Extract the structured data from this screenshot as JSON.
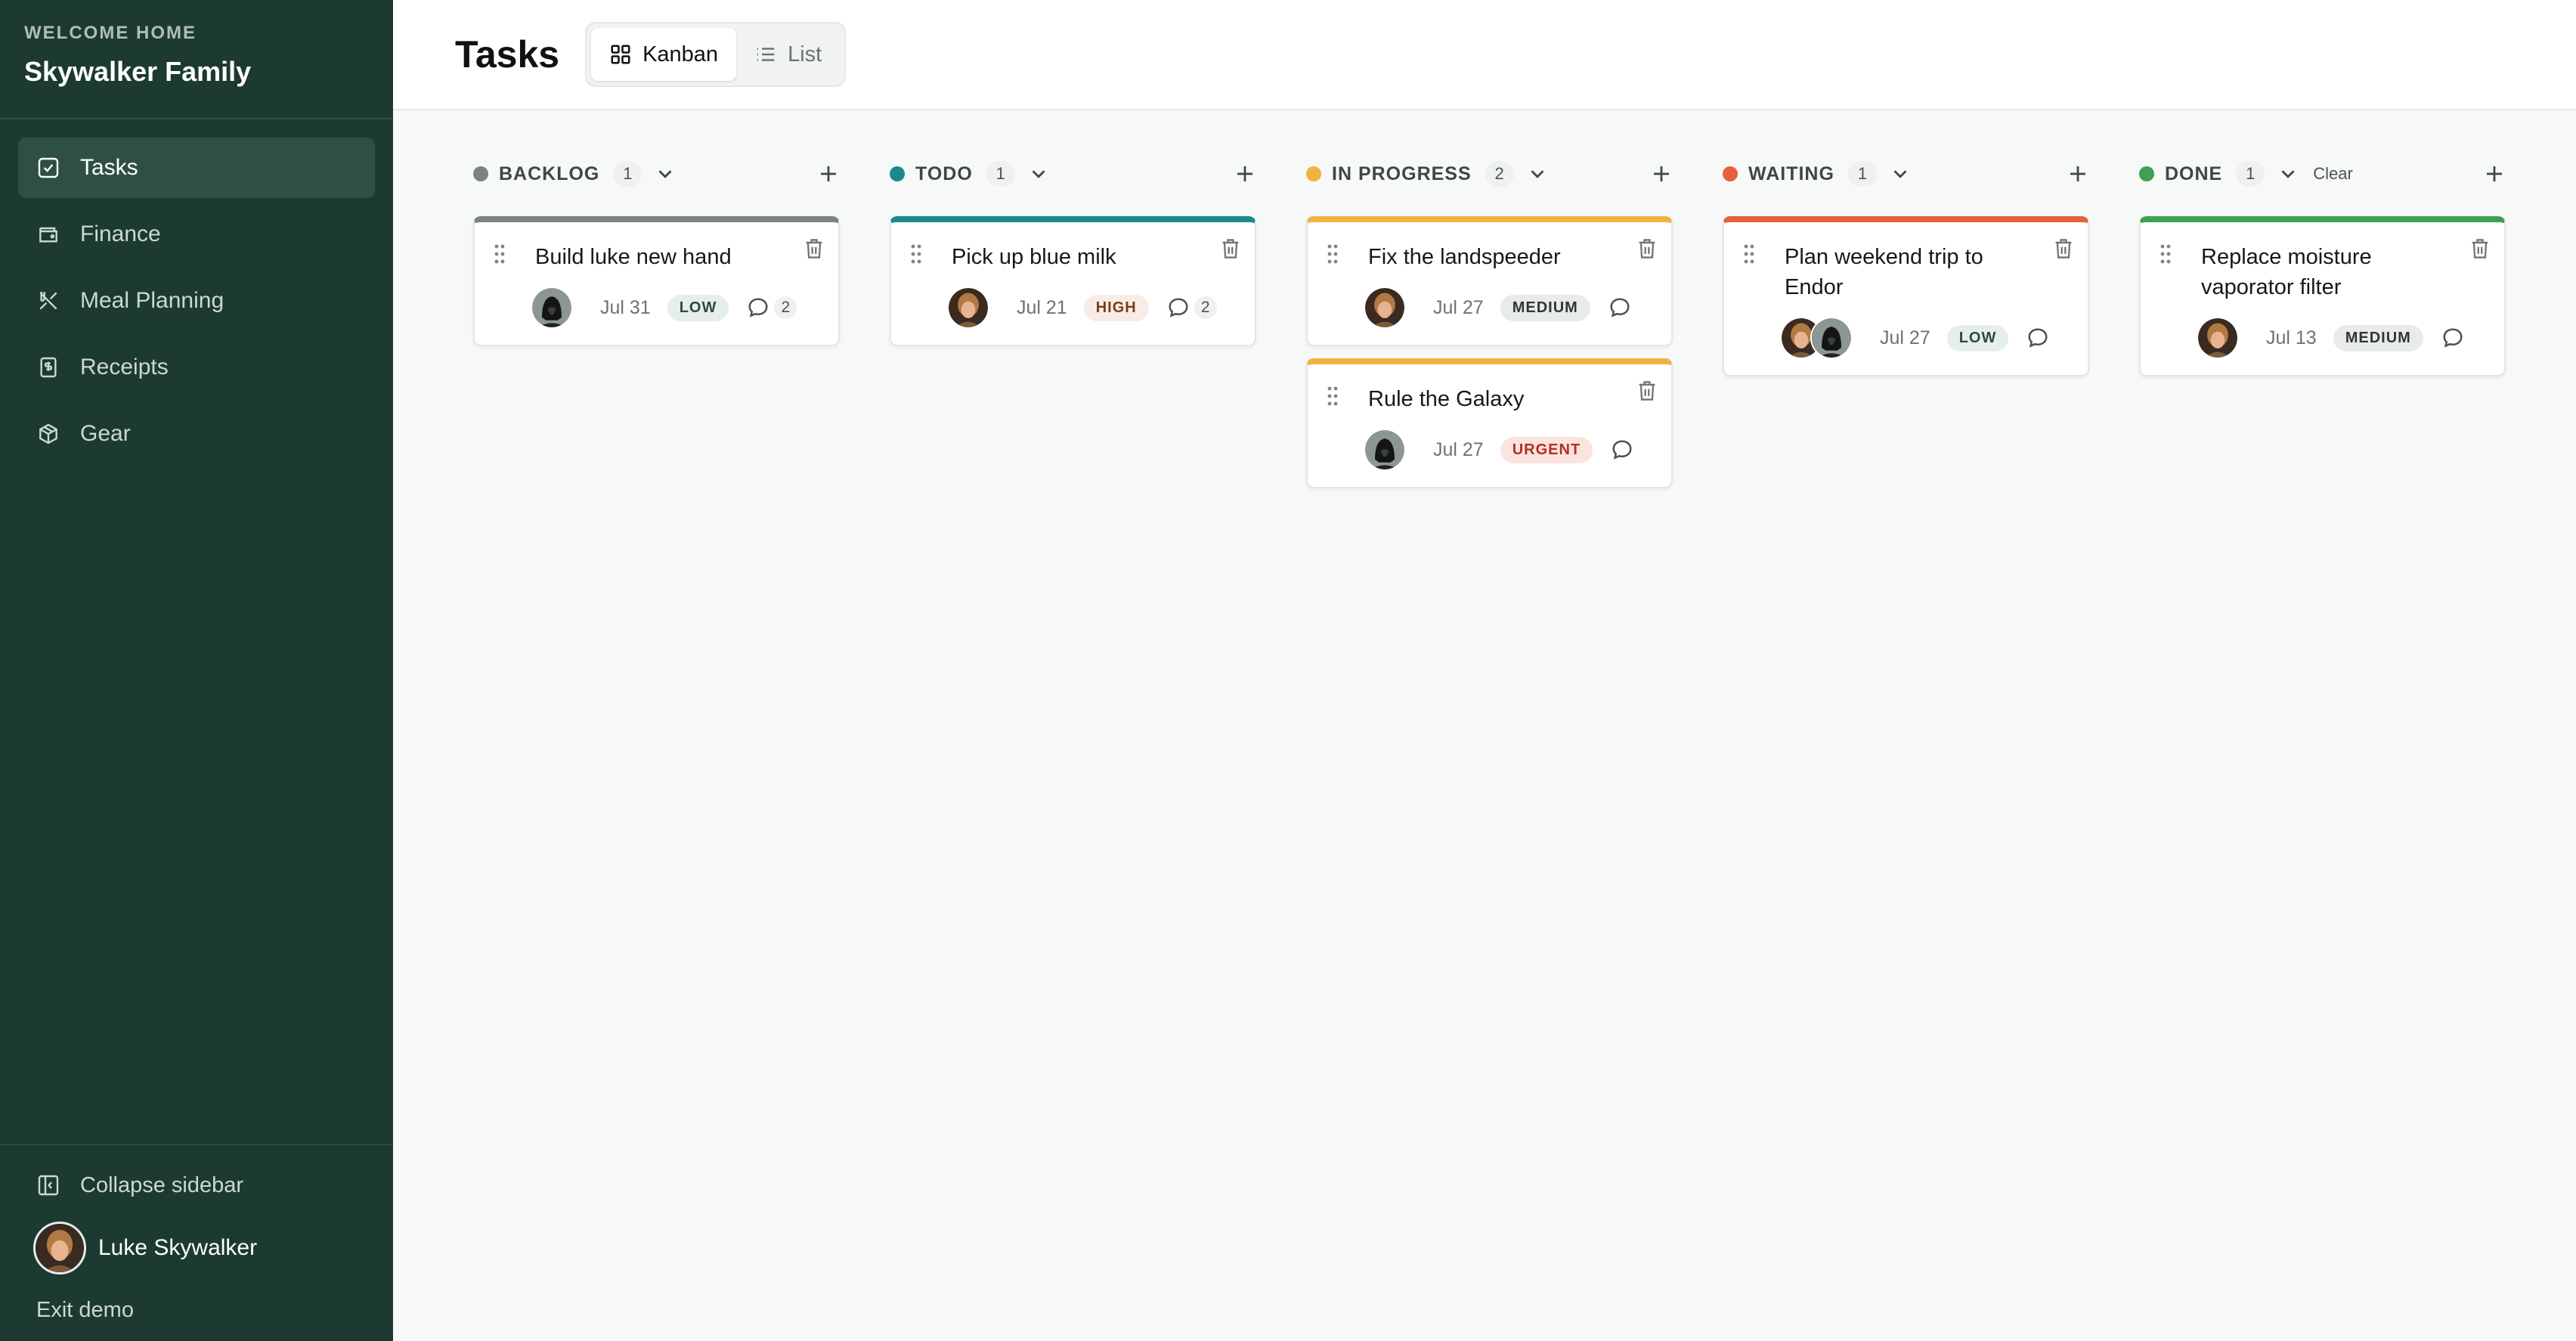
{
  "sidebar": {
    "welcome": "WELCOME HOME",
    "family": "Skywalker Family",
    "items": [
      {
        "label": "Tasks",
        "icon": "checkbox-icon"
      },
      {
        "label": "Finance",
        "icon": "wallet-icon"
      },
      {
        "label": "Meal Planning",
        "icon": "utensils-icon"
      },
      {
        "label": "Receipts",
        "icon": "receipt-icon"
      },
      {
        "label": "Gear",
        "icon": "package-icon"
      }
    ],
    "collapse_label": "Collapse sidebar",
    "user_name": "Luke Skywalker",
    "exit_label": "Exit demo"
  },
  "header": {
    "title": "Tasks",
    "views": [
      {
        "label": "Kanban",
        "icon": "grid-icon",
        "active": true
      },
      {
        "label": "List",
        "icon": "list-icon",
        "active": false
      }
    ]
  },
  "colors": {
    "sidebar_bg": "#1c3a32",
    "backlog": "#7b8482",
    "todo": "#1b8a8c",
    "in_progress": "#f0b33f",
    "waiting": "#e5603c",
    "done": "#3fa052"
  },
  "columns": [
    {
      "name": "BACKLOG",
      "count": "1",
      "color": "#7b8482",
      "cards": [
        {
          "title": "Build luke new hand",
          "date": "Jul 31",
          "priority": "LOW",
          "comments": "2"
        }
      ]
    },
    {
      "name": "TODO",
      "count": "1",
      "color": "#1b8a8c",
      "cards": [
        {
          "title": "Pick up blue milk",
          "date": "Jul 21",
          "priority": "HIGH",
          "comments": "2"
        }
      ]
    },
    {
      "name": "IN PROGRESS",
      "count": "2",
      "color": "#f0b33f",
      "cards": [
        {
          "title": "Fix the landspeeder",
          "date": "Jul 27",
          "priority": "MEDIUM",
          "comments": ""
        },
        {
          "title": "Rule the Galaxy",
          "date": "Jul 27",
          "priority": "URGENT",
          "comments": ""
        }
      ]
    },
    {
      "name": "WAITING",
      "count": "1",
      "color": "#e5603c",
      "cards": [
        {
          "title": "Plan weekend trip to Endor",
          "date": "Jul 27",
          "priority": "LOW",
          "comments": ""
        }
      ]
    },
    {
      "name": "DONE",
      "count": "1",
      "color": "#3fa052",
      "clear_label": "Clear",
      "cards": [
        {
          "title": "Replace moisture vaporator filter",
          "date": "Jul 13",
          "priority": "MEDIUM",
          "comments": ""
        }
      ]
    }
  ]
}
